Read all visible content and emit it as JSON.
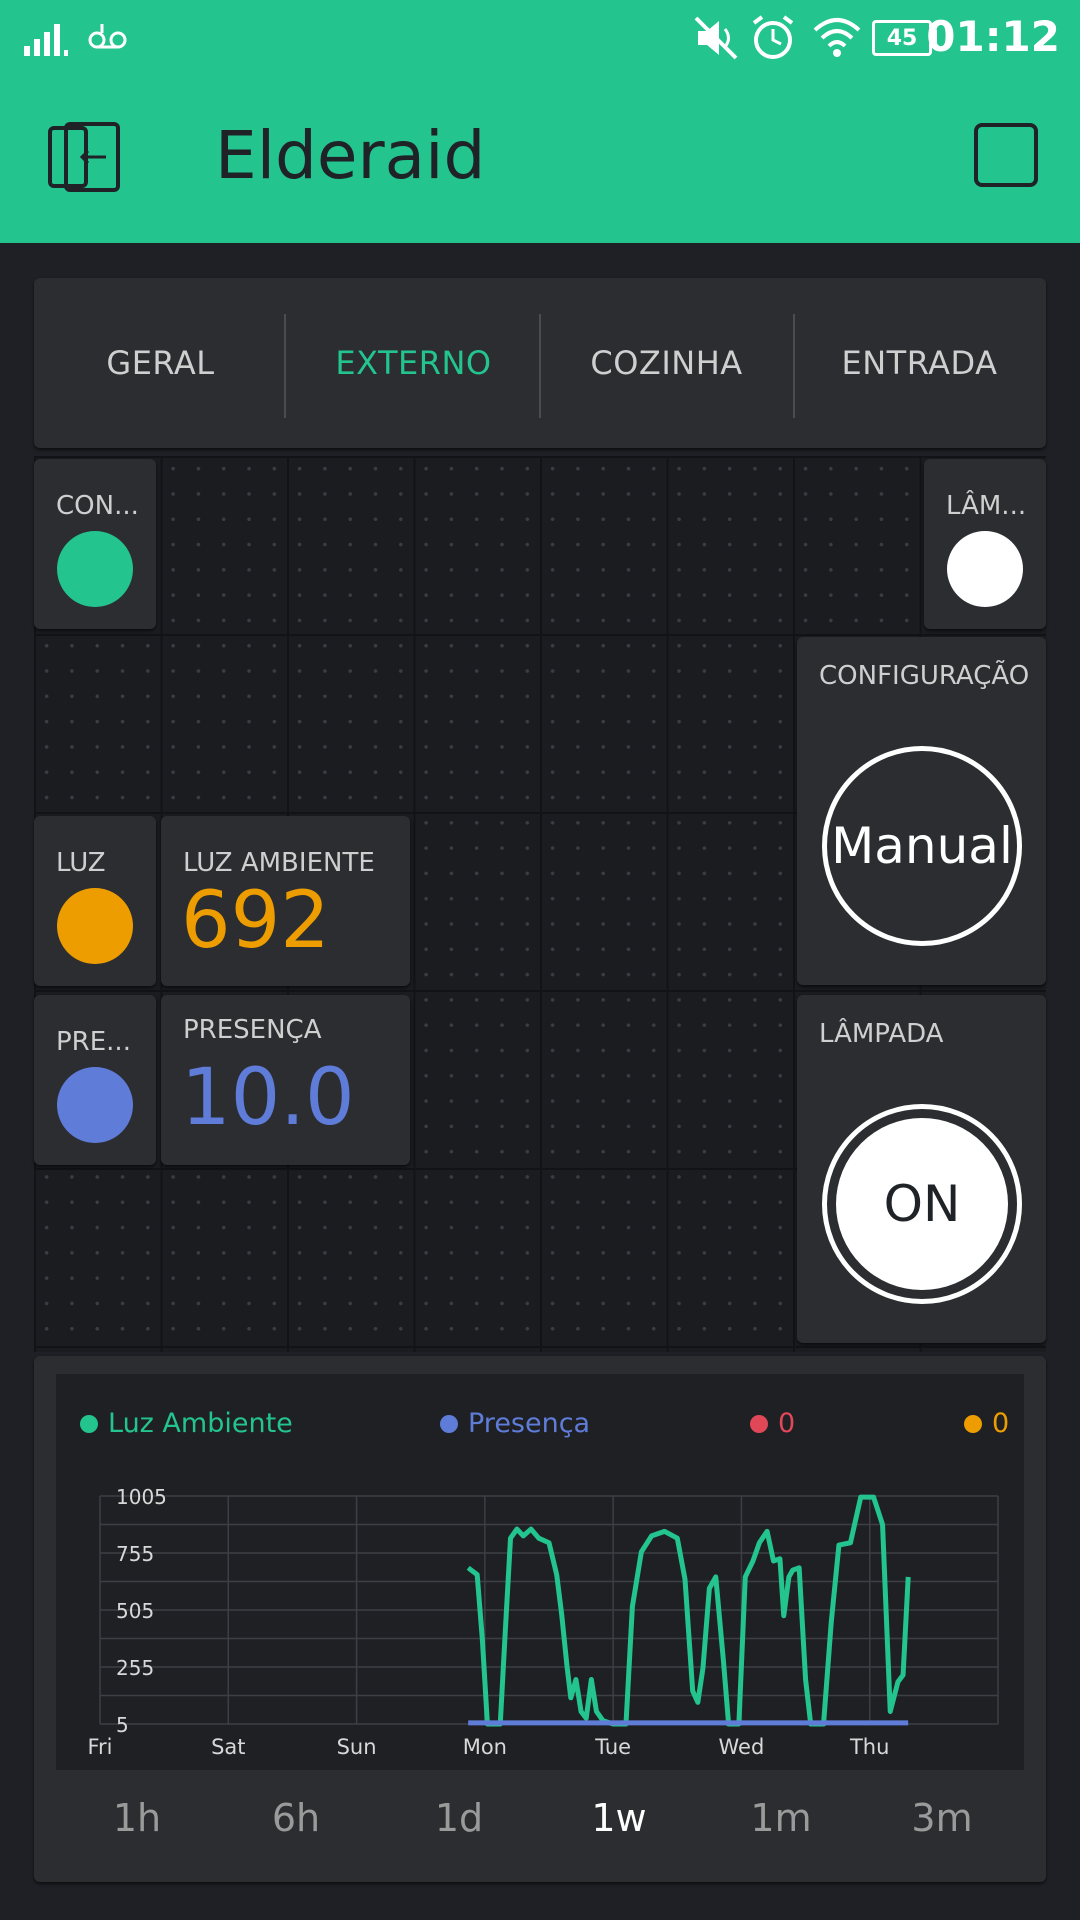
{
  "status_bar": {
    "time": "01:12",
    "battery": "45"
  },
  "app_bar": {
    "title": "Elderaid"
  },
  "tabs": [
    {
      "label": "GERAL",
      "active": false
    },
    {
      "label": "EXTERNO",
      "active": true
    },
    {
      "label": "COZINHA",
      "active": false
    },
    {
      "label": "ENTRADA",
      "active": false
    }
  ],
  "widgets": {
    "led_con": {
      "label": "CON...",
      "color": "#23c48e"
    },
    "led_lam": {
      "label": "LÂM...",
      "color": "#ffffff"
    },
    "config": {
      "label": "CONFIGURAÇÃO",
      "button": "Manual"
    },
    "led_luz": {
      "label": "LUZ",
      "color": "#ed9d00"
    },
    "luz_ambiente": {
      "label": "LUZ AMBIENTE",
      "value": "692",
      "color": "#ed9d00"
    },
    "led_pre": {
      "label": "PRE...",
      "color": "#5f7cd8"
    },
    "presenca": {
      "label": "PRESENÇA",
      "value": "10.0",
      "color": "#5f7cd8"
    },
    "lampada": {
      "label": "LÂMPADA",
      "button": "ON"
    }
  },
  "chart": {
    "legend": [
      {
        "name": "Luz Ambiente",
        "color": "#23c48e"
      },
      {
        "name": "Presença",
        "color": "#5f7cd8"
      },
      {
        "name": "0",
        "color": "#e04858"
      },
      {
        "name": "0",
        "color": "#ed9d00"
      }
    ],
    "ranges": [
      {
        "label": "1h",
        "active": false
      },
      {
        "label": "6h",
        "active": false
      },
      {
        "label": "1d",
        "active": false
      },
      {
        "label": "1w",
        "active": true
      },
      {
        "label": "1m",
        "active": false
      },
      {
        "label": "3m",
        "active": false
      }
    ]
  },
  "chart_data": {
    "type": "line",
    "x_ticks": [
      "Fri",
      "Sat",
      "Sun",
      "Mon",
      "Tue",
      "Wed",
      "Thu"
    ],
    "y_ticks": [
      "1005",
      "755",
      "505",
      "255",
      "5"
    ],
    "ylim": [
      5,
      1005
    ],
    "xlim_days": [
      0,
      7
    ],
    "grid": true,
    "legend_position": "top",
    "series": [
      {
        "name": "Luz Ambiente",
        "color": "#23c48e",
        "points": [
          [
            2.87,
            690
          ],
          [
            2.94,
            660
          ],
          [
            2.98,
            380
          ],
          [
            3.02,
            5
          ],
          [
            3.12,
            5
          ],
          [
            3.16,
            420
          ],
          [
            3.2,
            820
          ],
          [
            3.25,
            860
          ],
          [
            3.3,
            830
          ],
          [
            3.36,
            860
          ],
          [
            3.42,
            820
          ],
          [
            3.5,
            800
          ],
          [
            3.56,
            660
          ],
          [
            3.6,
            480
          ],
          [
            3.64,
            260
          ],
          [
            3.67,
            120
          ],
          [
            3.71,
            200
          ],
          [
            3.75,
            60
          ],
          [
            3.79,
            30
          ],
          [
            3.83,
            200
          ],
          [
            3.87,
            60
          ],
          [
            3.92,
            20
          ],
          [
            4.0,
            5
          ],
          [
            4.1,
            5
          ],
          [
            4.15,
            520
          ],
          [
            4.22,
            760
          ],
          [
            4.3,
            830
          ],
          [
            4.4,
            850
          ],
          [
            4.5,
            820
          ],
          [
            4.56,
            640
          ],
          [
            4.62,
            150
          ],
          [
            4.66,
            100
          ],
          [
            4.7,
            250
          ],
          [
            4.75,
            600
          ],
          [
            4.8,
            650
          ],
          [
            4.86,
            280
          ],
          [
            4.9,
            5
          ],
          [
            4.98,
            5
          ],
          [
            5.03,
            650
          ],
          [
            5.09,
            720
          ],
          [
            5.14,
            800
          ],
          [
            5.2,
            850
          ],
          [
            5.25,
            720
          ],
          [
            5.3,
            730
          ],
          [
            5.33,
            480
          ],
          [
            5.37,
            650
          ],
          [
            5.4,
            680
          ],
          [
            5.45,
            690
          ],
          [
            5.5,
            200
          ],
          [
            5.54,
            5
          ],
          [
            5.64,
            5
          ],
          [
            5.7,
            450
          ],
          [
            5.76,
            790
          ],
          [
            5.85,
            800
          ],
          [
            5.93,
            1000
          ],
          [
            6.03,
            1000
          ],
          [
            6.1,
            880
          ],
          [
            6.16,
            60
          ],
          [
            6.22,
            190
          ],
          [
            6.26,
            220
          ],
          [
            6.3,
            650
          ]
        ]
      },
      {
        "name": "Presença",
        "color": "#5f7cd8",
        "points": [
          [
            2.87,
            10
          ],
          [
            6.3,
            10
          ]
        ]
      }
    ]
  }
}
